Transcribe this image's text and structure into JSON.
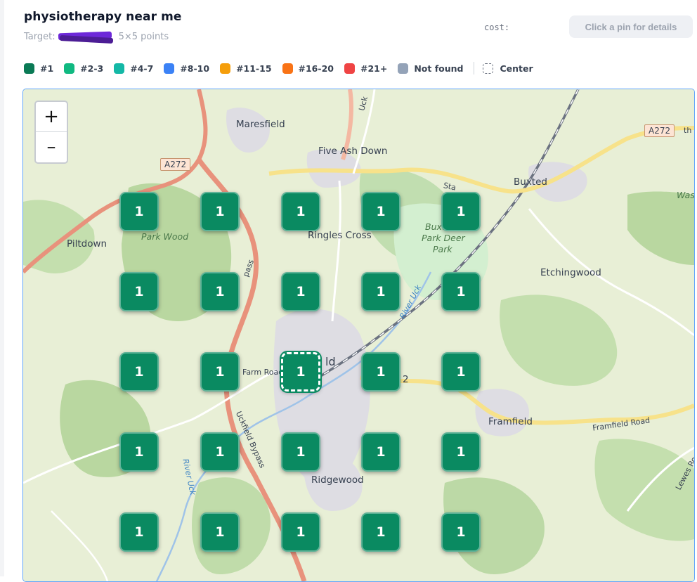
{
  "header": {
    "title": "physiotherapy near me",
    "target_label": "Target:",
    "points_label": "5×5 points",
    "cost_label": "cost:",
    "details_button": "Click a pin for details"
  },
  "legend": [
    {
      "label": "#1",
      "color": "#0a7a55"
    },
    {
      "label": "#2-3",
      "color": "#10b981"
    },
    {
      "label": "#4-7",
      "color": "#14b8a6"
    },
    {
      "label": "#8-10",
      "color": "#3b82f6"
    },
    {
      "label": "#11-15",
      "color": "#f59e0b"
    },
    {
      "label": "#16-20",
      "color": "#f97316"
    },
    {
      "label": "#21+",
      "color": "#ef4444"
    },
    {
      "label": "Not found",
      "color": "#94a3b8"
    }
  ],
  "legend_center": "Center",
  "map": {
    "zoom_in": "+",
    "zoom_out": "–",
    "labels": {
      "maresfield": "Maresfield",
      "five_ash_down": "Five Ash Down",
      "buxted": "Buxted",
      "park_wood": "Park Wood",
      "piltdown": "Piltdown",
      "ringles_cross": "Ringles Cross",
      "buxted_park": "Buxted",
      "park_deer": "Park Deer",
      "park": "Park",
      "etchingwood": "Etchingwood",
      "river_uck": "River Uck",
      "farm_road": "Farm Road",
      "framfield": "Framfield",
      "framfield_road": "Framfield Road",
      "ridgewood": "Ridgewood",
      "uckfield_bypass": "Uckfield Bypass",
      "river_uck_2": "River Uck",
      "lewes_road": "Lewes Ro",
      "station_road": "Sta",
      "was": "Was",
      "uck": "Uck",
      "ld": "ld",
      "a22_partial": "2",
      "bypass_partial": "pass",
      "road_partial": "Road"
    },
    "shields": {
      "a272_left": "A272",
      "a272_right": "A272",
      "th": "th"
    }
  },
  "grid": {
    "rows": [
      [
        "1",
        "1",
        "1",
        "1",
        "1"
      ],
      [
        "1",
        "1",
        "1",
        "1",
        "1"
      ],
      [
        "1",
        "1",
        "1",
        "1",
        "1"
      ],
      [
        "1",
        "1",
        "1",
        "1",
        "1"
      ],
      [
        "1",
        "1",
        "1",
        "1",
        "1"
      ]
    ]
  }
}
